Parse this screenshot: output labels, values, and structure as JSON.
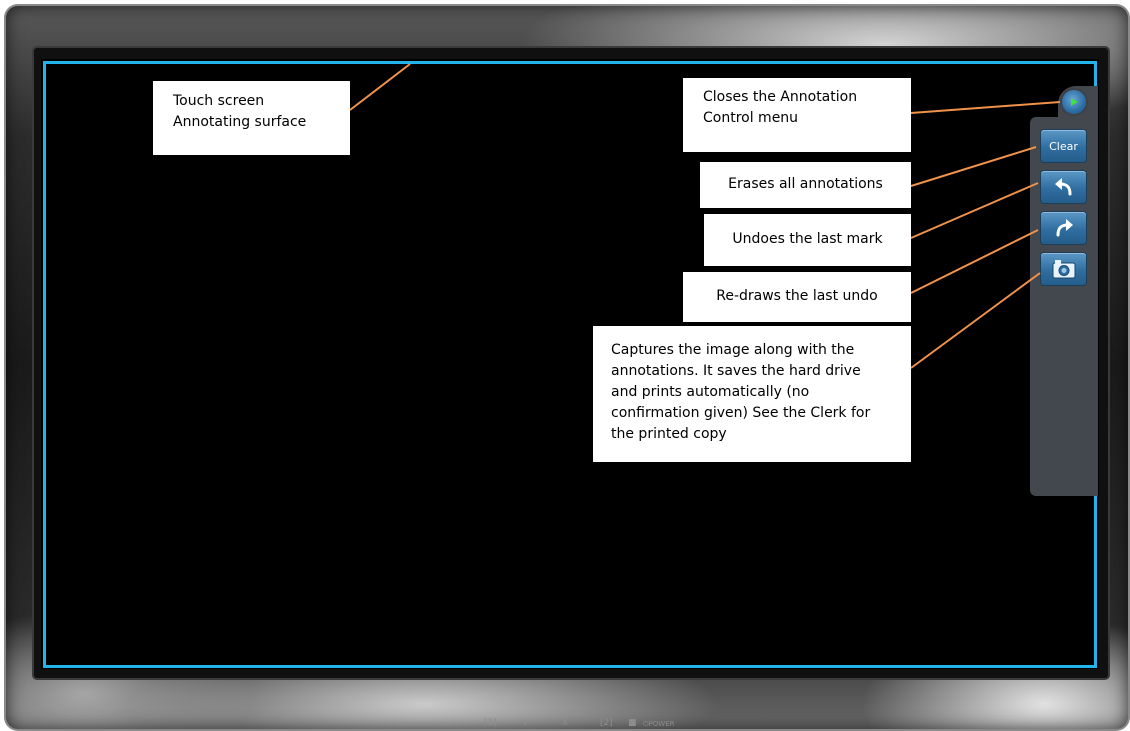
{
  "callouts": {
    "touch_screen": [
      "Touch screen",
      "Annotating surface"
    ],
    "close_menu": [
      "Closes the Annotation",
      "Control menu"
    ],
    "erase_all": "Erases all annotations",
    "undo": "Undoes the last mark",
    "redraw": "Re-draws the last undo",
    "capture": [
      "Captures the image along with the",
      "annotations. It saves the hard drive",
      "and prints automatically (no",
      "confirmation given) See the Clerk for",
      "the printed copy"
    ]
  },
  "panel": {
    "clear_label": "Clear",
    "icons": {
      "close": "play-triangle-icon",
      "undo": "undo-arrow-icon",
      "redo": "redo-arrow-icon",
      "capture": "camera-icon"
    }
  },
  "monitor_controls": [
    "[1]",
    "∨",
    "∧",
    "[2]",
    "■",
    "⏻POWER"
  ],
  "colors": {
    "screen_border": "#21b3ea",
    "leader_line": "#f0924a",
    "panel": "#42484d",
    "button": "#2f6ea0"
  }
}
